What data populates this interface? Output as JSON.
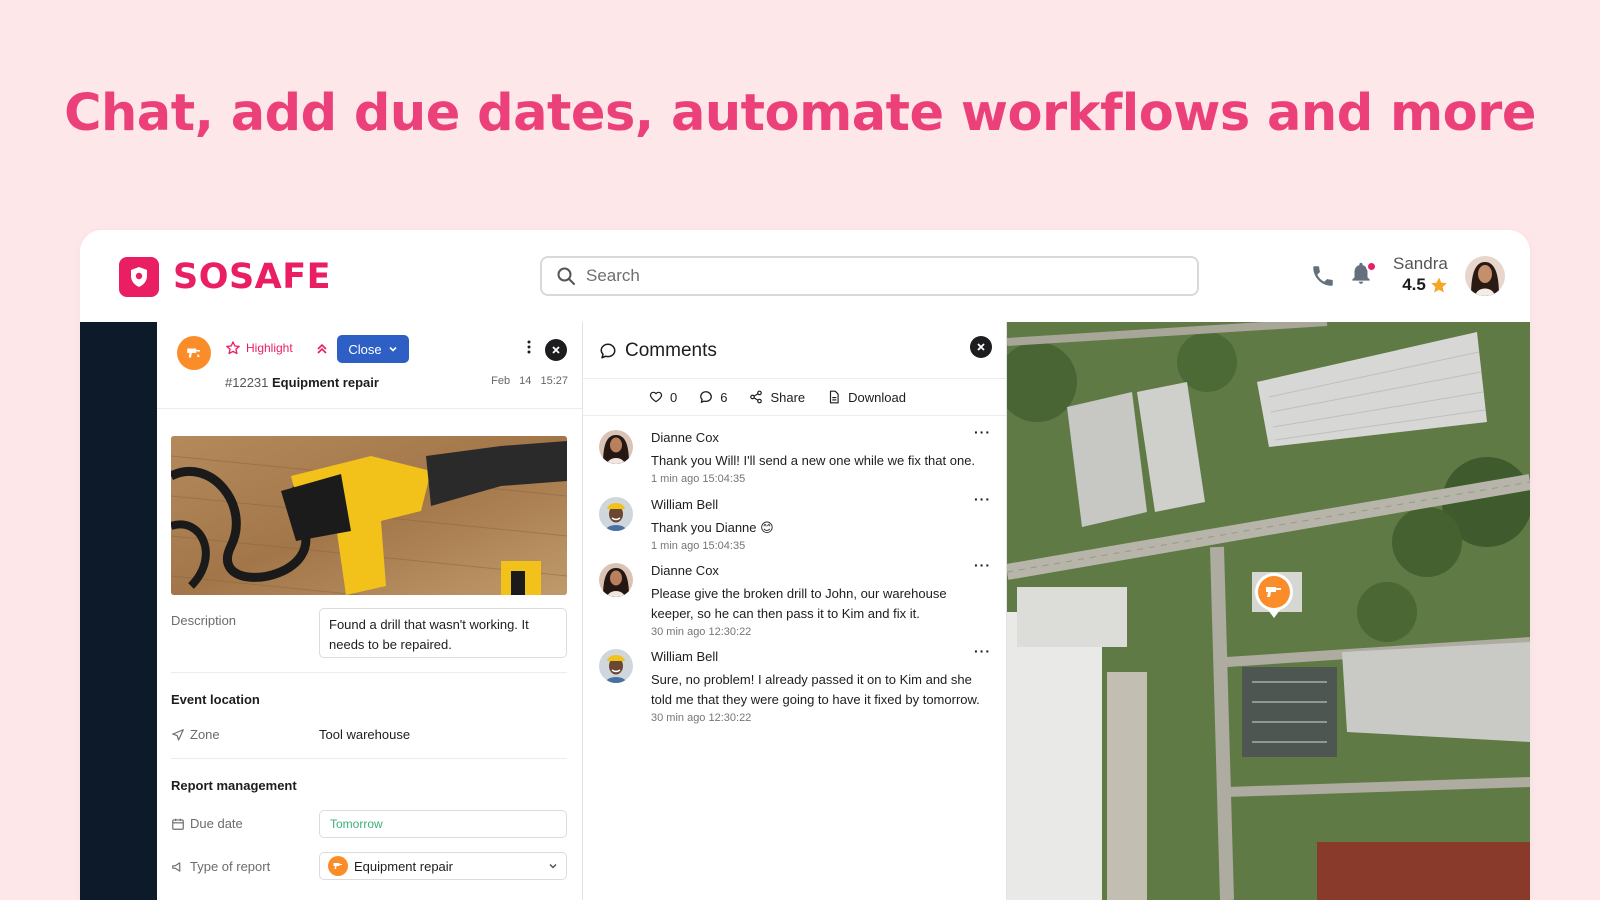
{
  "headline": "Chat, add due dates, automate workflows and more",
  "brand": {
    "name": "SOSAFE",
    "color": "#e91e63"
  },
  "search": {
    "placeholder": "Search"
  },
  "user": {
    "name": "Sandra",
    "rating": "4.5"
  },
  "report": {
    "highlight_label": "Highlight",
    "close_label": "Close",
    "id": "#12231",
    "title": "Equipment repair",
    "date": "Feb 14",
    "time": "15:27",
    "description_label": "Description",
    "description": "Found a drill that wasn't working. It needs to be repaired.",
    "event_location_title": "Event location",
    "zone_label": "Zone",
    "zone_value": "Tool warehouse",
    "management_title": "Report management",
    "due_date_label": "Due date",
    "due_date_value": "Tomorrow",
    "type_label": "Type of report",
    "type_value": "Equipment repair"
  },
  "comments": {
    "title": "Comments",
    "likes": "0",
    "count": "6",
    "share_label": "Share",
    "download_label": "Download",
    "items": [
      {
        "author": "Dianne Cox",
        "text": "Thank you Will! I'll send a new one while we fix that one.",
        "time": "1 min ago 15:04:35"
      },
      {
        "author": "William Bell",
        "text": "Thank you Dianne 😊",
        "time": "1 min ago 15:04:35"
      },
      {
        "author": "Dianne Cox",
        "text": "Please give the broken drill to John, our warehouse keeper, so he can then pass it to Kim and fix it.",
        "time": "30 min ago 12:30:22"
      },
      {
        "author": "William Bell",
        "text": "Sure, no problem! I already passed it on to Kim and she told me that they were going to have it fixed by tomorrow.",
        "time": "30 min ago 12:30:22"
      }
    ]
  },
  "colors": {
    "accent": "#e91e63",
    "primary_button": "#2d5fc4",
    "sidebar": "#0d1a2a",
    "report_type": "#fb8c2a",
    "due_green": "#3bb07a"
  }
}
